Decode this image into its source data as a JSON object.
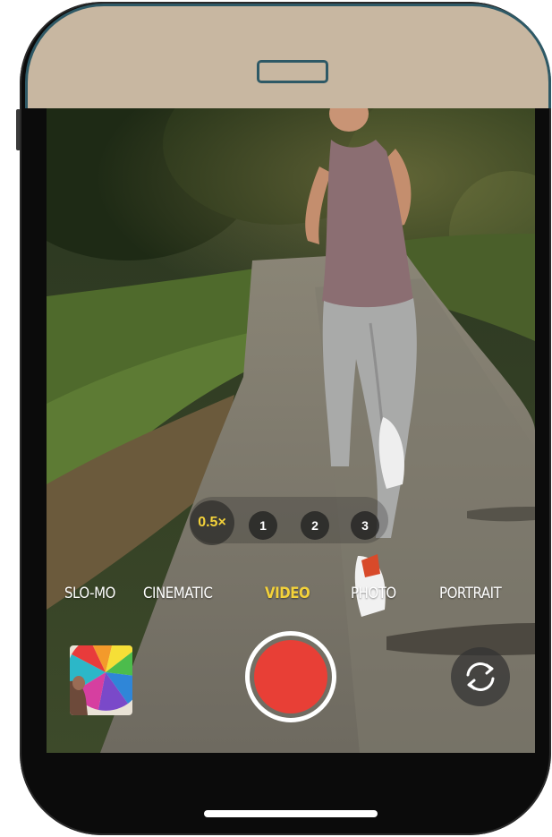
{
  "camera": {
    "zoom_levels": [
      "0.5×",
      "1",
      "2",
      "3"
    ],
    "selected_zoom": "0.5×",
    "modes": [
      "SLO-MO",
      "CINEMATIC",
      "VIDEO",
      "PHOTO",
      "PORTRAIT"
    ],
    "selected_mode": "VIDEO"
  },
  "icons": {
    "shutter": "record-button",
    "flip": "camera-flip-icon",
    "thumbnail": "photo-thumbnail"
  },
  "colors": {
    "accent_yellow": "#f4d23a",
    "record_red": "#e83f36",
    "frame_tan": "#c8b7a1",
    "frame_outline": "#2e5966"
  }
}
